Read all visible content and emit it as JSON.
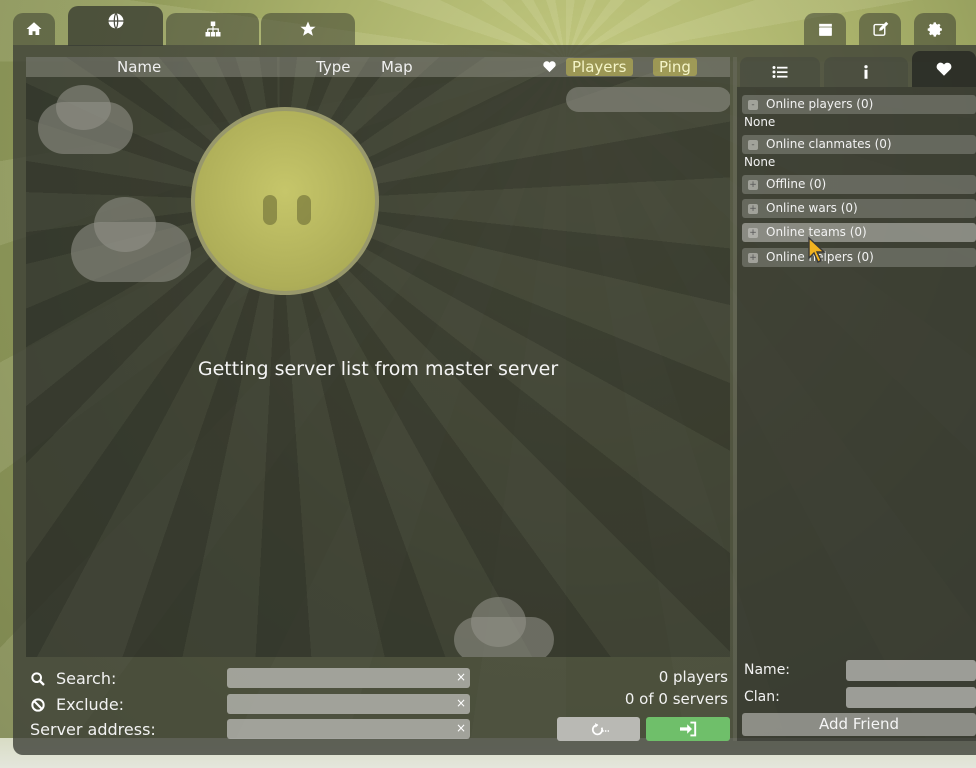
{
  "top_tabs": [
    {
      "name": "home",
      "icon": "home-icon",
      "active": false
    },
    {
      "name": "internet",
      "icon": "globe-icon",
      "active": true
    },
    {
      "name": "lan",
      "icon": "network-icon",
      "active": false
    },
    {
      "name": "favorites",
      "icon": "star-icon",
      "active": false
    }
  ],
  "right_tabs": [
    {
      "name": "demos",
      "icon": "clapperboard-icon"
    },
    {
      "name": "editor",
      "icon": "edit-icon"
    },
    {
      "name": "settings",
      "icon": "gear-icon"
    }
  ],
  "server_list": {
    "columns": {
      "name": "Name",
      "type": "Type",
      "map": "Map",
      "players": "Players",
      "ping": "Ping"
    },
    "status_message": "Getting server list from master server"
  },
  "filters": {
    "search_label": "Search:",
    "exclude_label": "Exclude:",
    "server_address_label": "Server address:",
    "search_value": "",
    "exclude_value": "",
    "server_address_value": "",
    "clear_symbol": "×"
  },
  "stats": {
    "players": "0 players",
    "servers": "0 of 0 servers"
  },
  "friends": {
    "tabs": [
      {
        "name": "list",
        "icon": "list-icon"
      },
      {
        "name": "info",
        "icon": "info-icon"
      },
      {
        "name": "friends",
        "icon": "heart-icon",
        "active": true
      }
    ],
    "groups": [
      {
        "label": "Online players (0)",
        "toggle": "-",
        "content": "None"
      },
      {
        "label": "Online clanmates (0)",
        "toggle": "-",
        "content": "None"
      },
      {
        "label": "Offline (0)",
        "toggle": "+"
      },
      {
        "label": "Online wars (0)",
        "toggle": "+"
      },
      {
        "label": "Online teams (0)",
        "toggle": "+"
      },
      {
        "label": "Online helpers (0)",
        "toggle": "+"
      }
    ],
    "name_label": "Name:",
    "clan_label": "Clan:",
    "name_value": "",
    "clan_value": "",
    "add_button": "Add Friend"
  },
  "colors": {
    "connect_button": "#6fbf6a",
    "refresh_button": "#b9b9b4",
    "sort_highlight": "#c8be50"
  }
}
